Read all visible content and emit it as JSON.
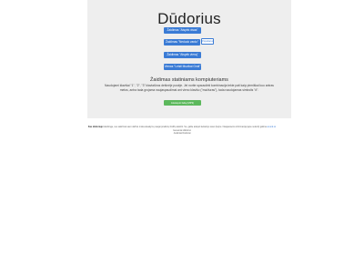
{
  "app": {
    "title": "Dūdorius"
  },
  "menu": {
    "buttons": [
      {
        "label": "Žaidimas \"Atspėk visas\""
      },
      {
        "label": "Žaidimas \"Neduok vardo\""
      },
      {
        "label": "Žaidimas \"Atspėk vieną\""
      },
      {
        "label": "Vienas \"Leisti Muzikai Groti\""
      }
    ],
    "badge": "Populiarus"
  },
  "rules": {
    "heading": "Žaidimas statiniams kompiuteriams",
    "text": "Naudojami klavišai \"1\", \"2\", \"3\" klaviatūros dešinėje pusėje. Jei norite spausdinti kombinacija tekte pati kaip pirmiškai kuo antras metos, antra tada grojama naujaspaudimai ant vieno klavišo (\"mažiuras\"), tada naudojamas simbolis \"#\".",
    "start_button": "Atsisiųsti failą (MP3)"
  },
  "footer": {
    "lead": "Kas dūdoriuje",
    "line1": " klavišinga, nes sakrtmai savo dažnis moka atsakymų naujai pradinių žodžių atskirti. Su, galite atsiųsti keliantys savo (lie)nė. Naujausiems informacija (apie sukurti) galima",
    "link": "at.unk.xx",
    "line2": "Geresniai didinimo",
    "line3": "Juokiniai Dūdoriai"
  }
}
